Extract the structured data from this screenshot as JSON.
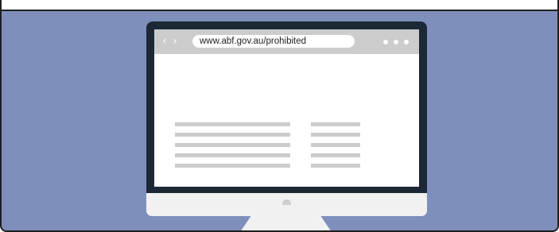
{
  "browser": {
    "url": "www.abf.gov.au/prohibited",
    "back_icon": "chevron-left-icon",
    "forward_icon": "chevron-right-icon",
    "menu_icon": "more-horizontal-icon"
  },
  "page_content": {
    "left_column_lines": 5,
    "right_column_lines": 5
  },
  "colors": {
    "background": "#7f8fbc",
    "bezel": "#1c2836",
    "chin": "#f1f1f1",
    "browser_bar": "#cccccc",
    "placeholder_lines": "#cccccc"
  }
}
